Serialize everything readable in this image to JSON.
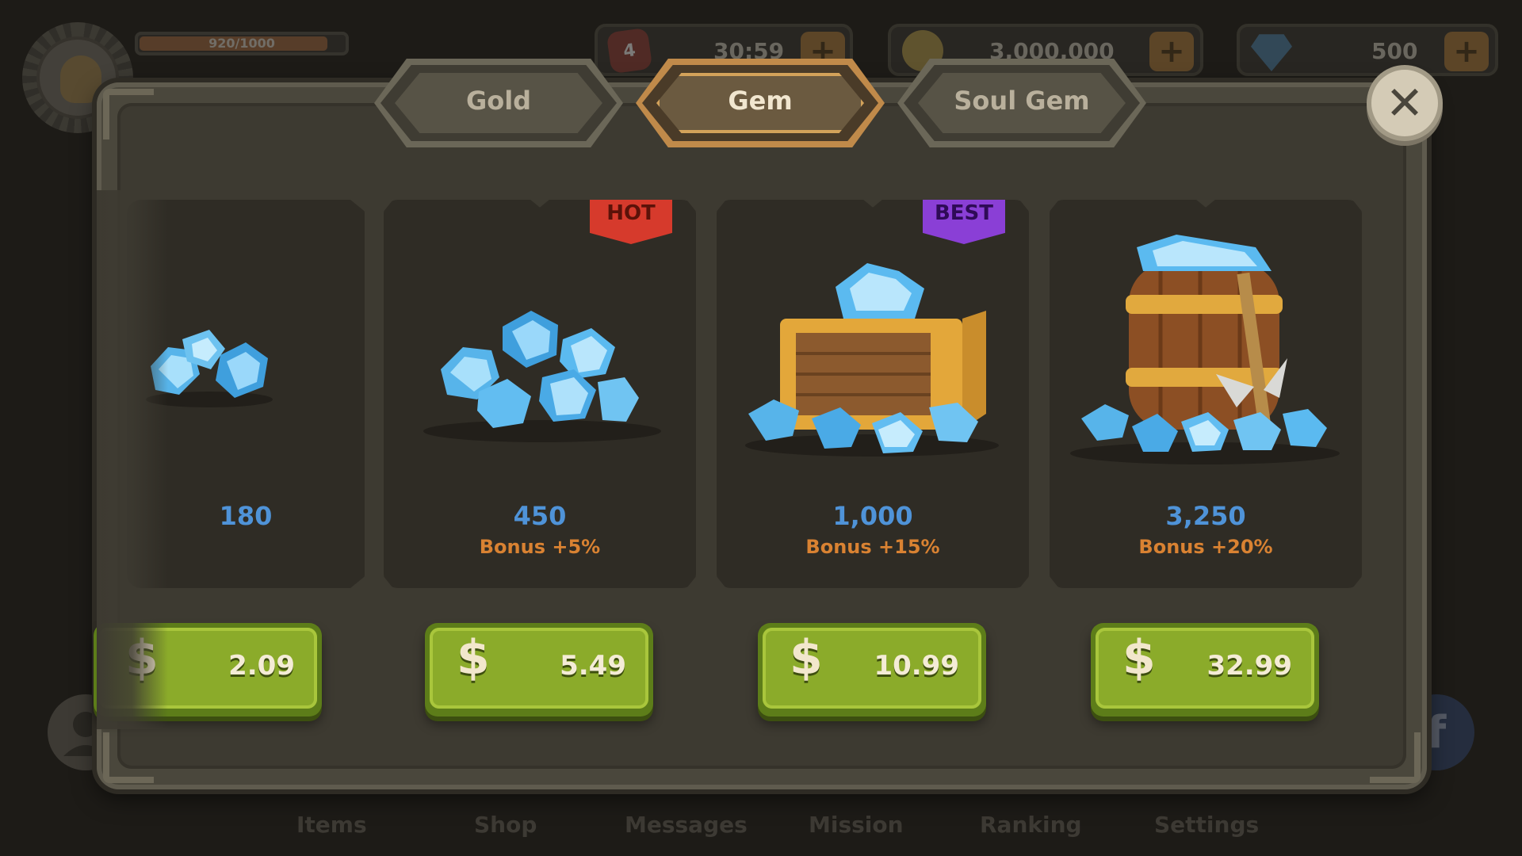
{
  "hud": {
    "xp_text": "920/1000",
    "xp_fraction": 0.92,
    "lives": "4",
    "timer": "30:59",
    "gold": "3,000,000",
    "gems": "500",
    "plus_label": "+"
  },
  "tabs": [
    {
      "label": "Gold",
      "active": false
    },
    {
      "label": "Gem",
      "active": true
    },
    {
      "label": "Soul Gem",
      "active": false
    }
  ],
  "close_label": "✕",
  "currency_symbol": "$",
  "offers": [
    {
      "amount": "180",
      "bonus": "",
      "price": "2.09",
      "badge": ""
    },
    {
      "amount": "450",
      "bonus": "Bonus +5%",
      "price": "5.49",
      "badge": "HOT"
    },
    {
      "amount": "1,000",
      "bonus": "Bonus +15%",
      "price": "10.99",
      "badge": "BEST"
    },
    {
      "amount": "3,250",
      "bonus": "Bonus +20%",
      "price": "32.99",
      "badge": ""
    }
  ],
  "bottom_nav": [
    "Items",
    "Shop",
    "Messages",
    "Mission",
    "Ranking",
    "Settings"
  ],
  "icons": {
    "lives": "heart-icon",
    "gold": "gold-coin-icon",
    "gems": "diamond-icon",
    "close": "close-icon",
    "facebook": "facebook-icon",
    "friends": "user-icon"
  }
}
